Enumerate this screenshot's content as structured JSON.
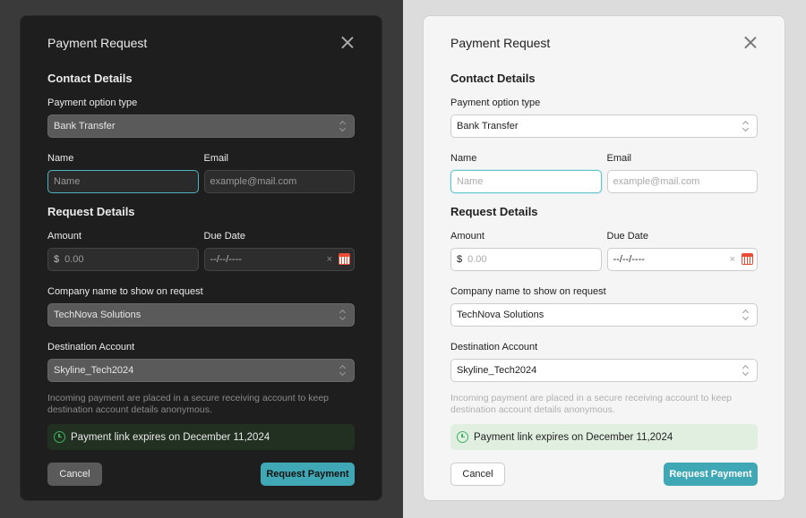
{
  "dialog": {
    "title": "Payment Request",
    "contact_section": "Contact Details",
    "payment_option_label": "Payment option type",
    "payment_option_value": "Bank Transfer",
    "name_label": "Name",
    "name_placeholder": "Name",
    "email_label": "Email",
    "email_placeholder": "example@mail.com",
    "request_section": "Request Details",
    "amount_label": "Amount",
    "amount_currency": "$",
    "amount_placeholder": "0.00",
    "due_date_label": "Due Date",
    "due_date_placeholder": "--/--/----",
    "due_date_clear": "×",
    "company_label": "Company name to show on request",
    "company_value": "TechNova Solutions",
    "destination_label": "Destination Account",
    "destination_value": "Skyline_Tech2024",
    "note": "Incoming payment are placed in a secure receiving account to keep destination account details anonymous.",
    "expiry": "Payment link expires on December 11,2024",
    "cancel_label": "Cancel",
    "submit_label": "Request Payment"
  },
  "themes": [
    "dark",
    "light"
  ],
  "colors": {
    "accent": "#3fa8b4",
    "focus": "#4fb3bd",
    "expiry_icon": "#3fb163",
    "calendar_icon": "#e94b35"
  },
  "icons": {
    "close": "close-icon",
    "select": "chevron-updown-icon",
    "calendar": "calendar-icon",
    "expiry": "alarm-clock-icon"
  }
}
